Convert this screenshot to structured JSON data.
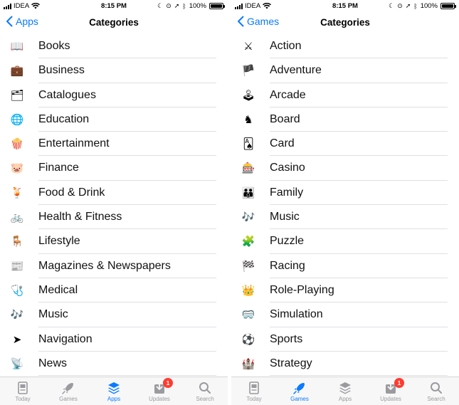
{
  "status": {
    "carrier": "IDEA",
    "time": "8:15 PM",
    "battery": "100%"
  },
  "left": {
    "back_label": "Apps",
    "title": "Categories",
    "rows": [
      {
        "label": "Books",
        "icon": "📖"
      },
      {
        "label": "Business",
        "icon": "💼"
      },
      {
        "label": "Catalogues",
        "icon": "🗂"
      },
      {
        "label": "Education",
        "icon": "🌐"
      },
      {
        "label": "Entertainment",
        "icon": "🍿"
      },
      {
        "label": "Finance",
        "icon": "🐷"
      },
      {
        "label": "Food & Drink",
        "icon": "🍹"
      },
      {
        "label": "Health & Fitness",
        "icon": "🚲"
      },
      {
        "label": "Lifestyle",
        "icon": "🪑"
      },
      {
        "label": "Magazines & Newspapers",
        "icon": "📰"
      },
      {
        "label": "Medical",
        "icon": "🩺"
      },
      {
        "label": "Music",
        "icon": "🎶"
      },
      {
        "label": "Navigation",
        "icon": "➤"
      },
      {
        "label": "News",
        "icon": "📡"
      }
    ]
  },
  "right": {
    "back_label": "Games",
    "title": "Categories",
    "rows": [
      {
        "label": "Action",
        "icon": "⚔"
      },
      {
        "label": "Adventure",
        "icon": "🏴"
      },
      {
        "label": "Arcade",
        "icon": "🕹"
      },
      {
        "label": "Board",
        "icon": "♞"
      },
      {
        "label": "Card",
        "icon": "🂡"
      },
      {
        "label": "Casino",
        "icon": "🎰"
      },
      {
        "label": "Family",
        "icon": "👪"
      },
      {
        "label": "Music",
        "icon": "🎶"
      },
      {
        "label": "Puzzle",
        "icon": "🧩"
      },
      {
        "label": "Racing",
        "icon": "🏁"
      },
      {
        "label": "Role-Playing",
        "icon": "👑"
      },
      {
        "label": "Simulation",
        "icon": "🥽"
      },
      {
        "label": "Sports",
        "icon": "⚽"
      },
      {
        "label": "Strategy",
        "icon": "🏰"
      }
    ]
  },
  "tabs": {
    "today": "Today",
    "games": "Games",
    "apps": "Apps",
    "updates": "Updates",
    "search": "Search",
    "updates_badge": "1"
  },
  "colors": {
    "accent": "#0a7aff",
    "badge": "#ff3b30",
    "inactive": "#9a9a9f"
  }
}
